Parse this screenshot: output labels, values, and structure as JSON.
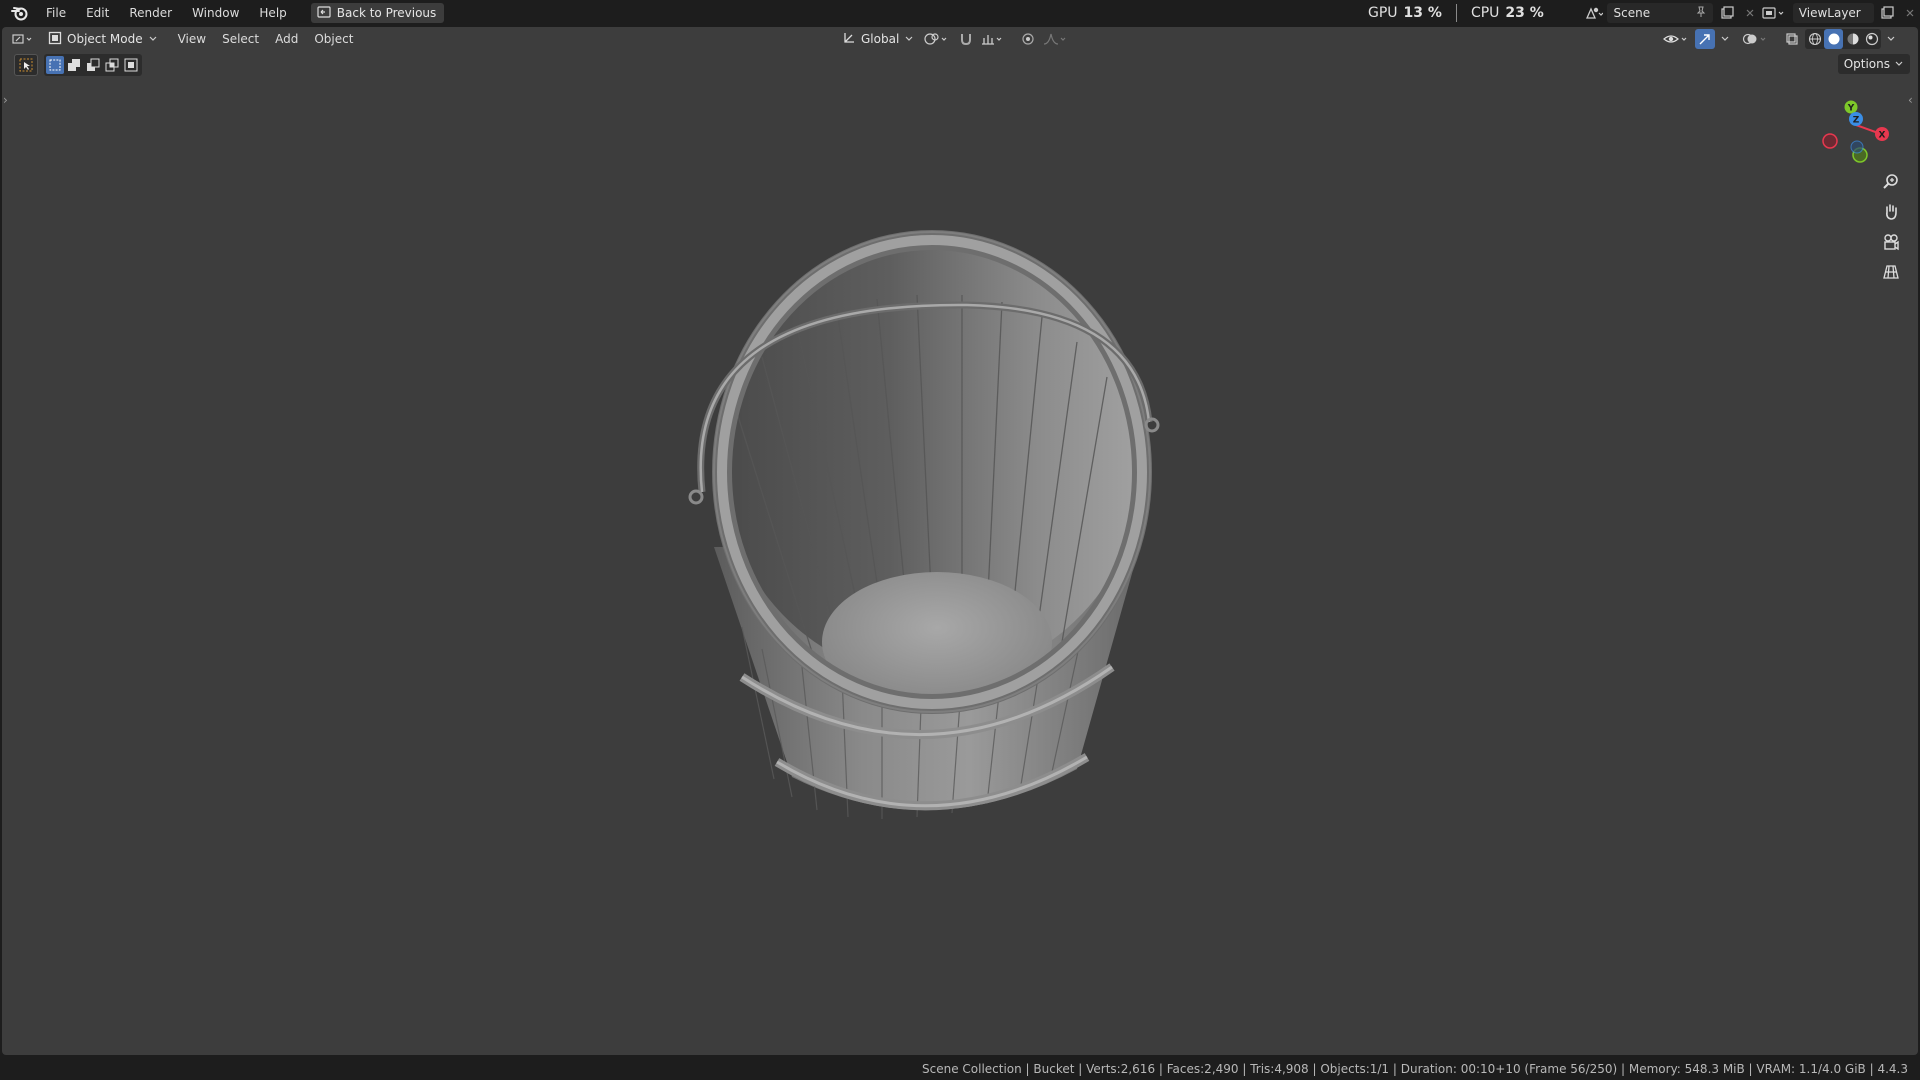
{
  "menubar": {
    "items": [
      "File",
      "Edit",
      "Render",
      "Window",
      "Help"
    ],
    "back_button": "Back to Previous"
  },
  "stats": {
    "gpu_label": "GPU",
    "gpu_value": "13 %",
    "cpu_label": "CPU",
    "cpu_value": "23 %"
  },
  "scene": {
    "name": "Scene"
  },
  "view_layer": {
    "name": "ViewLayer"
  },
  "viewport_header": {
    "mode": "Object Mode",
    "menus": [
      "View",
      "Select",
      "Add",
      "Object"
    ],
    "orientation": "Global",
    "options": "Options"
  },
  "gizmo": {
    "x": "X",
    "y": "Y",
    "z": "Z"
  },
  "status_bar": {
    "text": "Scene Collection | Bucket | Verts:2,616 | Faces:2,490 | Tris:4,908 | Objects:1/1 | Duration: 00:10+10 (Frame 56/250) | Memory: 548.3 MiB | VRAM: 1.1/4.0 GiB | 4.4.3"
  },
  "colors": {
    "accent": "#4772b3",
    "viewport_bg": "#3d3d3d",
    "axis_x": "#e8384f",
    "axis_y": "#7ec82a",
    "axis_z": "#3a8ee6"
  }
}
